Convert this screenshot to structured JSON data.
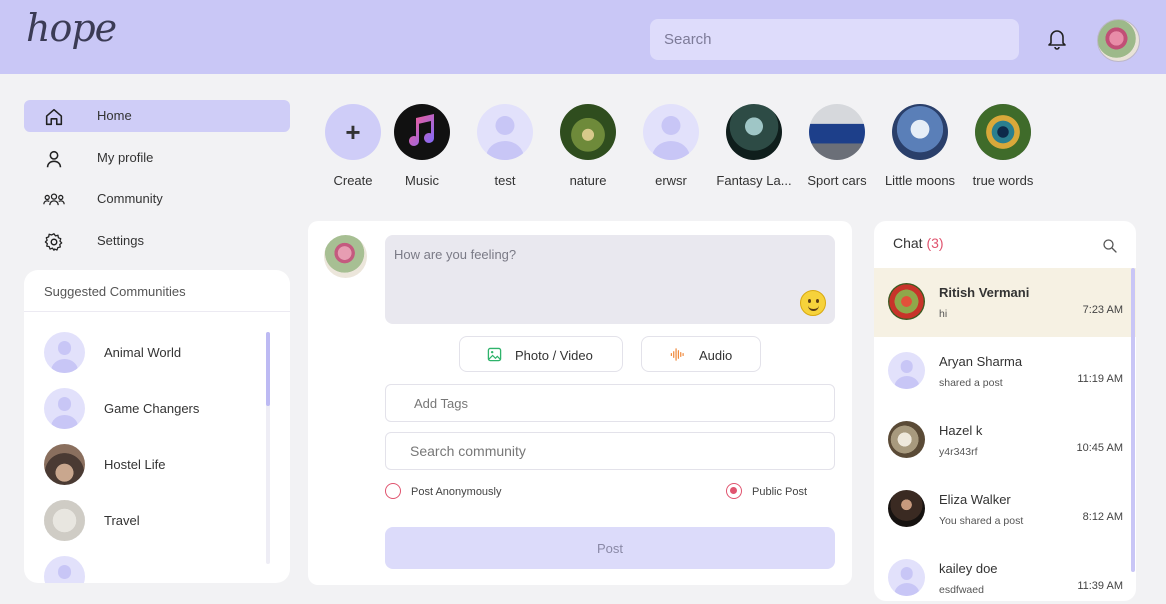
{
  "header": {
    "logo": "hope",
    "search_placeholder": "Search"
  },
  "nav": {
    "items": [
      {
        "label": "Home",
        "icon": "home-icon",
        "active": true
      },
      {
        "label": "My profile",
        "icon": "user-icon",
        "active": false
      },
      {
        "label": "Community",
        "icon": "community-icon",
        "active": false
      },
      {
        "label": "Settings",
        "icon": "gear-icon",
        "active": false
      }
    ]
  },
  "suggested": {
    "title": "Suggested Communities",
    "items": [
      {
        "name": "Animal World"
      },
      {
        "name": "Game Changers"
      },
      {
        "name": "Hostel Life"
      },
      {
        "name": "Travel"
      }
    ]
  },
  "stories": [
    {
      "label": "Create"
    },
    {
      "label": "Music"
    },
    {
      "label": "test"
    },
    {
      "label": "nature"
    },
    {
      "label": "erwsr"
    },
    {
      "label": "Fantasy La..."
    },
    {
      "label": "Sport cars"
    },
    {
      "label": "Little moons"
    },
    {
      "label": "true words"
    }
  ],
  "composer": {
    "placeholder": "How are you feeling?",
    "photo_label": "Photo / Video",
    "audio_label": "Audio",
    "tags_placeholder": "Add Tags",
    "community_placeholder": "Search community",
    "anon_label": "Post Anonymously",
    "public_label": "Public Post",
    "post_label": "Post"
  },
  "chat": {
    "title": "Chat",
    "count": "(3)",
    "items": [
      {
        "name": "Ritish Vermani",
        "message": "hi",
        "time": "7:23 AM"
      },
      {
        "name": "Aryan Sharma",
        "message": "shared a post",
        "time": "11:19 AM"
      },
      {
        "name": "Hazel k",
        "message": "y4r343rf",
        "time": "10:45 AM"
      },
      {
        "name": "Eliza Walker",
        "message": "You shared a post",
        "time": "8:12 AM"
      },
      {
        "name": "kailey doe",
        "message": "esdfwaed",
        "time": "11:39 AM"
      }
    ]
  },
  "colors": {
    "header": "#c9c7f6",
    "accent": "#cfcdf7",
    "alert": "#e0546f",
    "background": "#f2f2f4"
  }
}
